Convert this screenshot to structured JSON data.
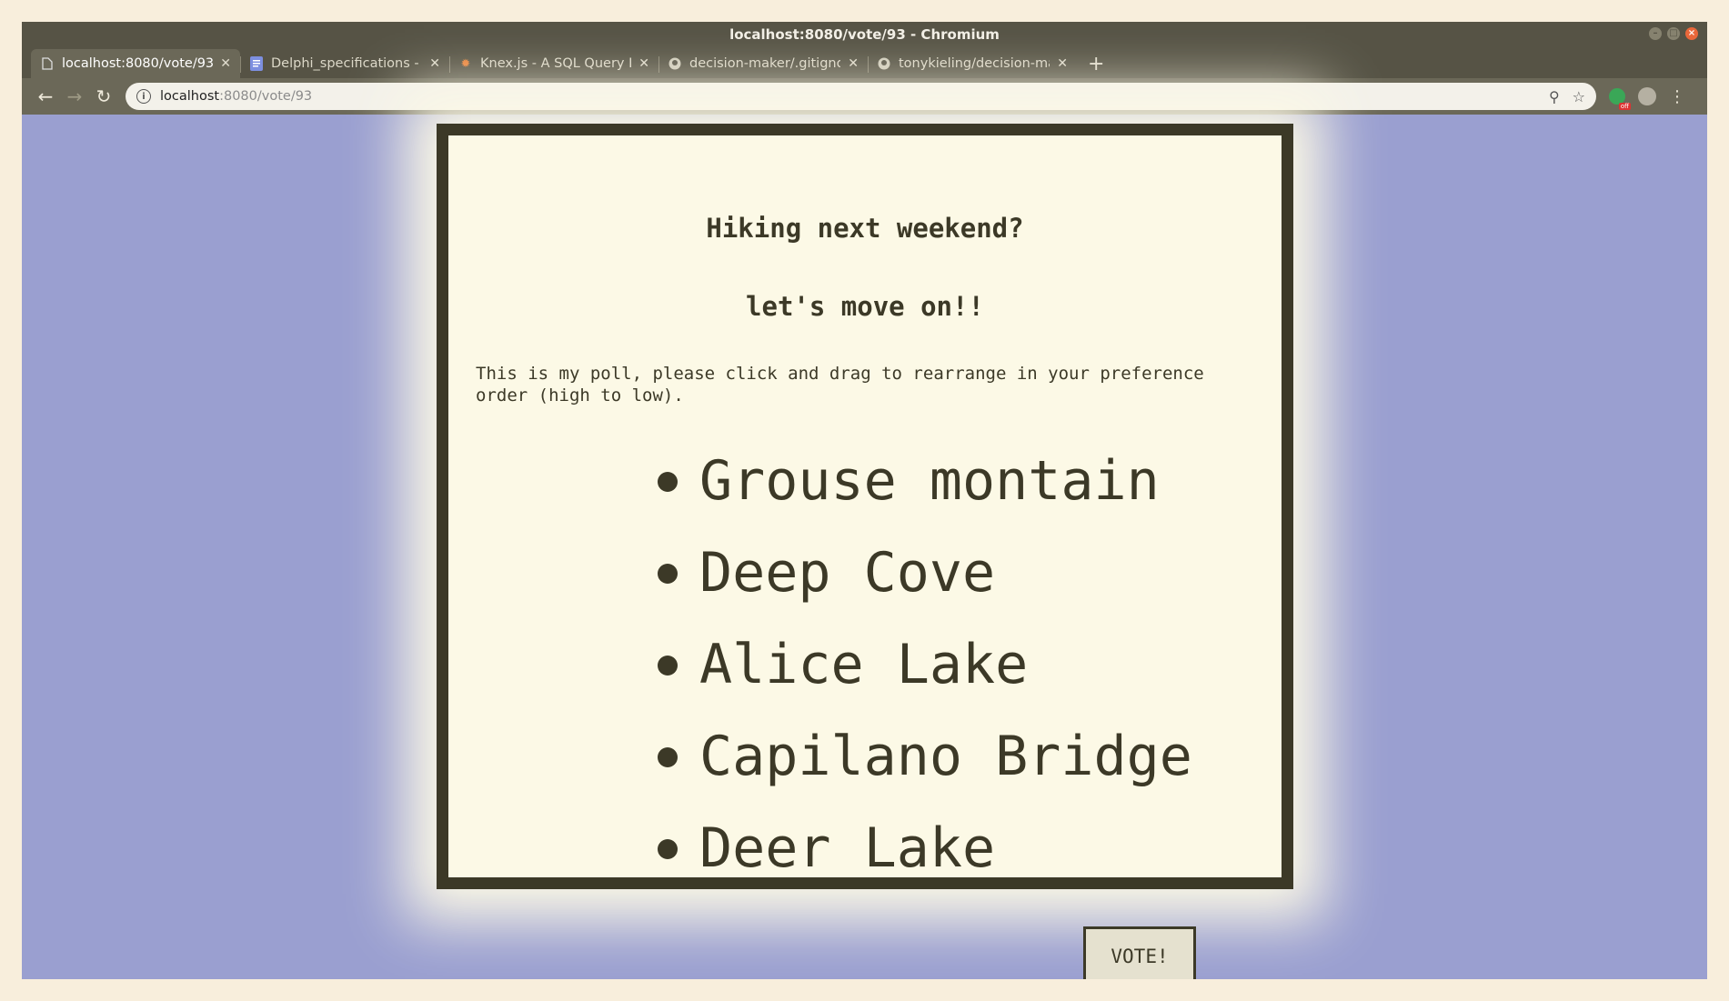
{
  "window": {
    "title": "localhost:8080/vote/93 - Chromium"
  },
  "tabs": [
    {
      "label": "localhost:8080/vote/93",
      "icon": "page-icon"
    },
    {
      "label": "Delphi_specifications - Go",
      "icon": "docs-icon"
    },
    {
      "label": "Knex.js - A SQL Query Bui",
      "icon": "knex-icon"
    },
    {
      "label": "decision-maker/.gitignore",
      "icon": "github-icon"
    },
    {
      "label": "tonykieling/decision-mak",
      "icon": "github-icon"
    }
  ],
  "address_bar": {
    "host": "localhost",
    "path": ":8080/vote/93"
  },
  "poll": {
    "title": "Hiking next weekend?",
    "subtitle": "let's move on!!",
    "description": "This is my poll, please click and drag to rearrange in your preference order (high to low).",
    "options": [
      "Grouse montain",
      "Deep Cove",
      "Alice Lake",
      "Capilano Bridge",
      "Deer Lake"
    ],
    "vote_label": "VOTE!"
  },
  "colors": {
    "page_background": "#9a9fd0",
    "card_background": "#fcf9e6",
    "card_border": "#3c3927"
  }
}
